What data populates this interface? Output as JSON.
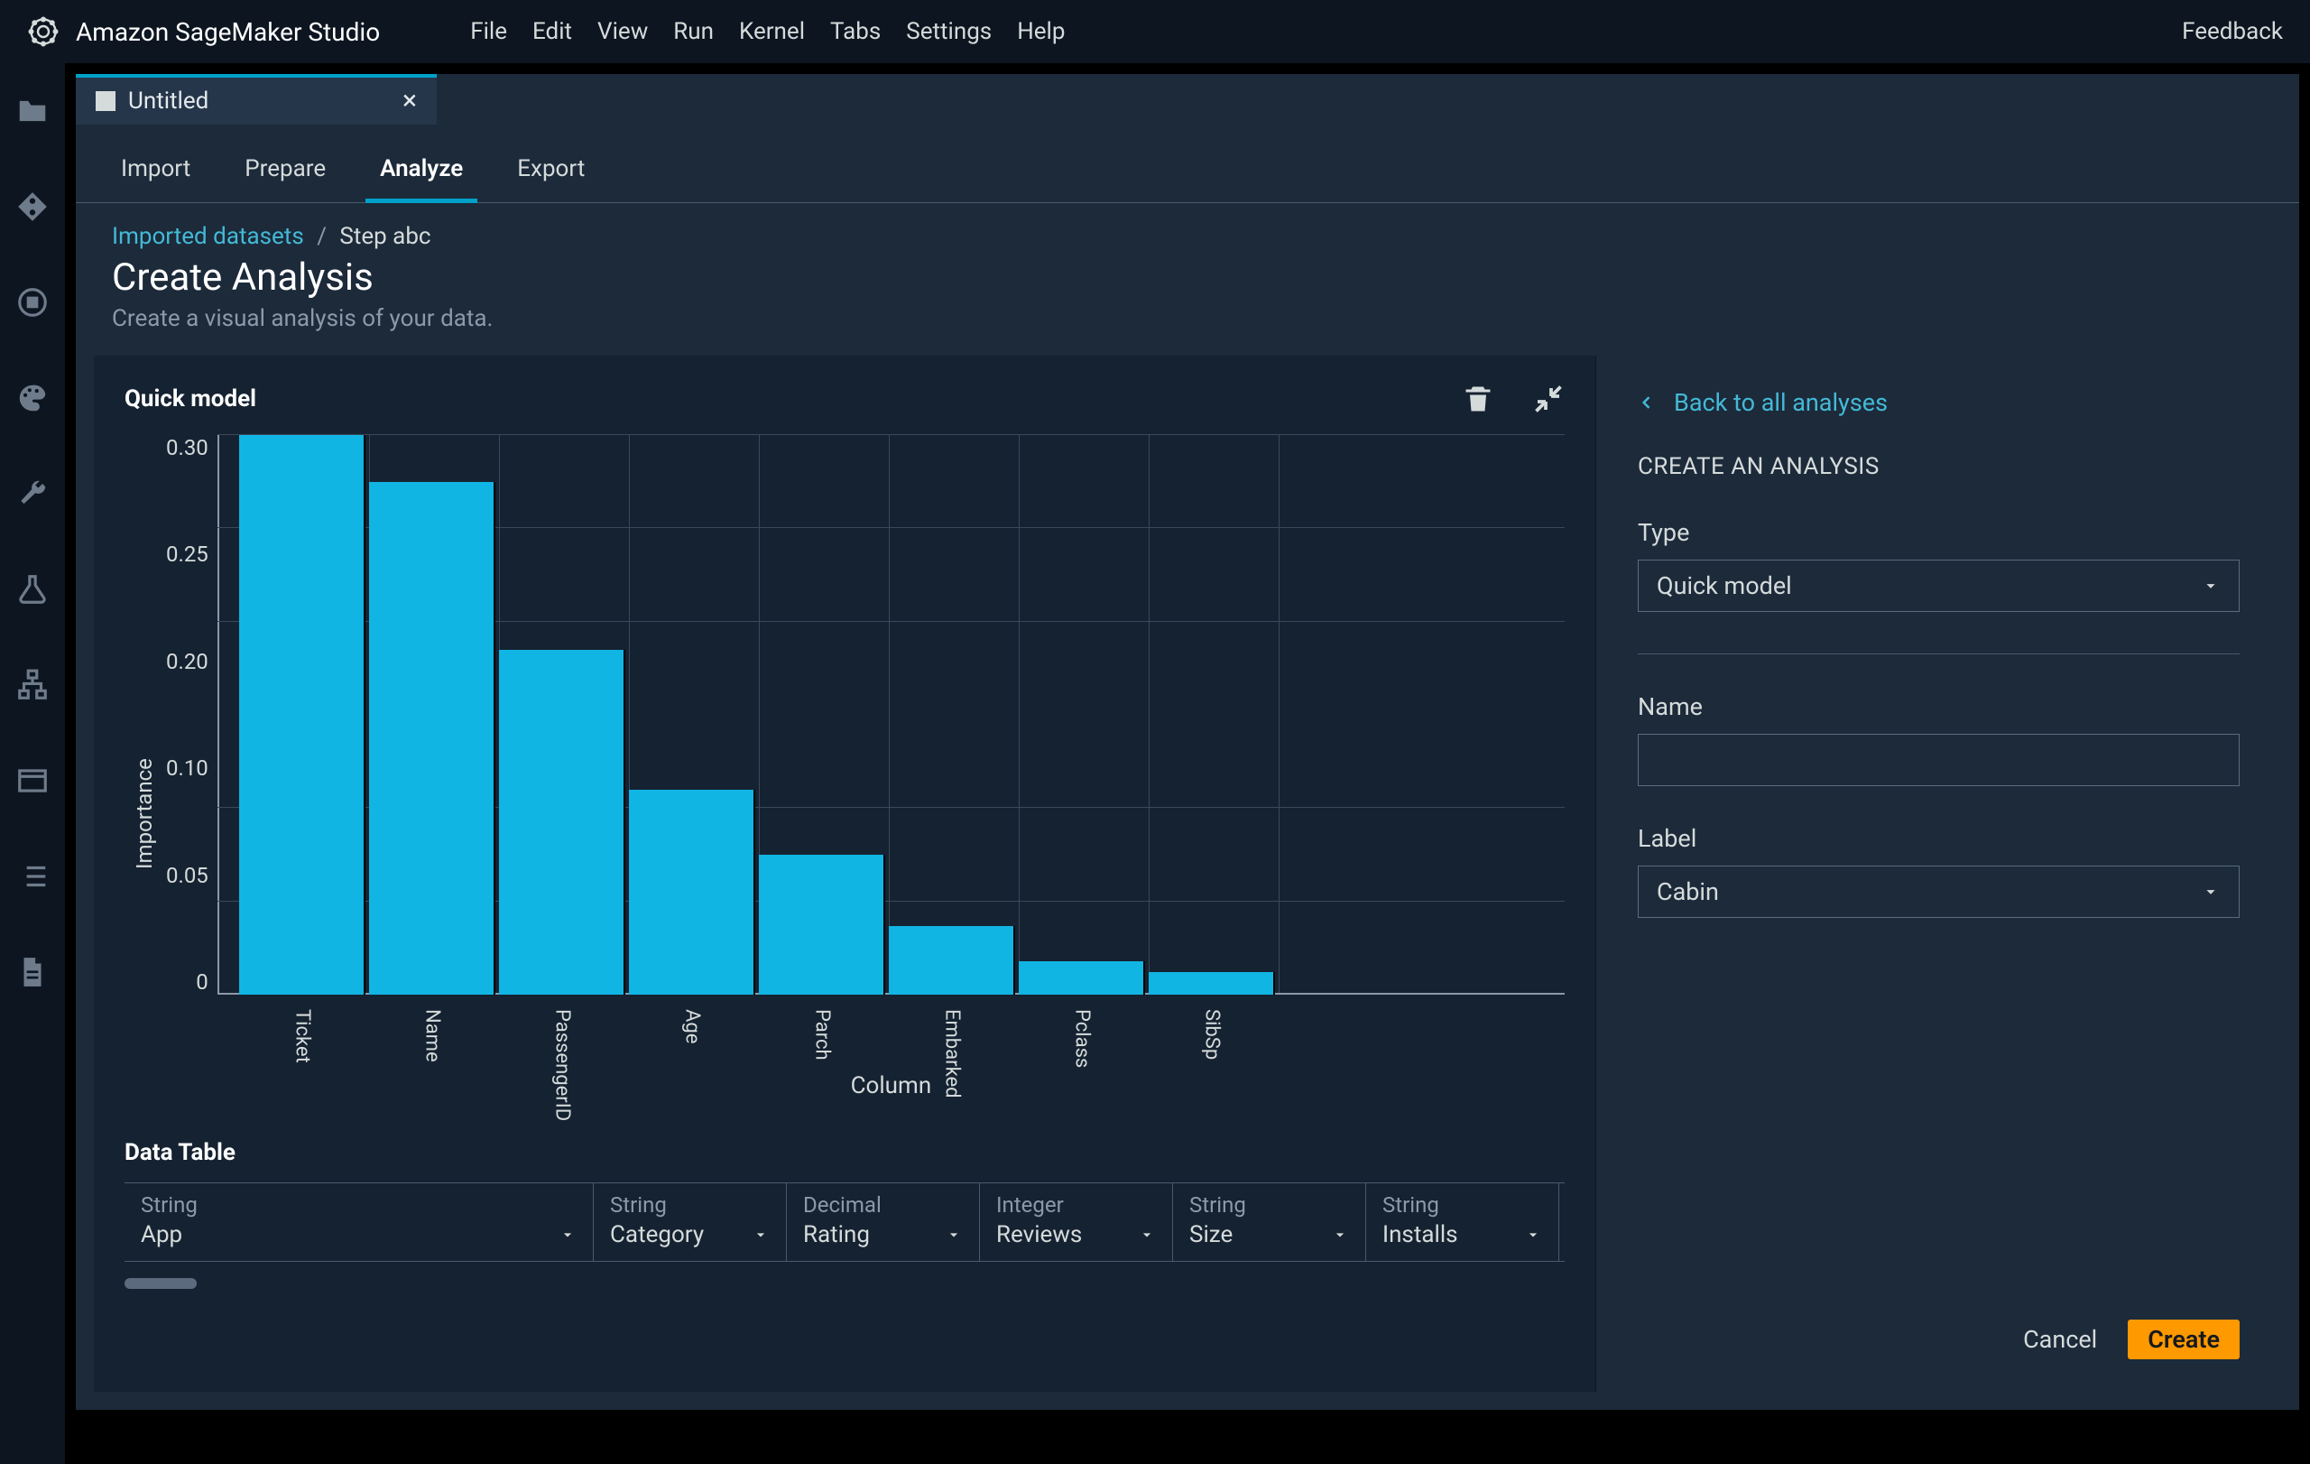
{
  "app": {
    "title": "Amazon SageMaker Studio"
  },
  "menu": {
    "items": [
      "File",
      "Edit",
      "View",
      "Run",
      "Kernel",
      "Tabs",
      "Settings",
      "Help"
    ],
    "feedback": "Feedback"
  },
  "doc_tab": {
    "title": "Untitled"
  },
  "mode_tabs": {
    "items": [
      "Import",
      "Prepare",
      "Analyze",
      "Export"
    ],
    "active": "Analyze"
  },
  "breadcrumb": {
    "link": "Imported datasets",
    "current": "Step abc"
  },
  "page": {
    "title": "Create Analysis",
    "subtitle": "Create a visual analysis of your data."
  },
  "chartpane": {
    "title": "Quick model",
    "data_table_title": "Data Table"
  },
  "chart_data": {
    "type": "bar",
    "title": "Quick model",
    "categories": [
      "Ticket",
      "Name",
      "PassengerID",
      "Age",
      "Parch",
      "Embarked",
      "Pclass",
      "SibSp"
    ],
    "values": [
      0.3,
      0.275,
      0.185,
      0.11,
      0.075,
      0.037,
      0.018,
      0.012
    ],
    "xlabel": "Column",
    "ylabel": "Importance",
    "ylim": [
      0,
      0.3
    ],
    "yticks": [
      0,
      0.05,
      0.1,
      0.2,
      0.25,
      0.3
    ]
  },
  "data_table": {
    "columns": [
      {
        "type": "String",
        "name": "App"
      },
      {
        "type": "String",
        "name": "Category"
      },
      {
        "type": "Decimal",
        "name": "Rating"
      },
      {
        "type": "Integer",
        "name": "Reviews"
      },
      {
        "type": "String",
        "name": "Size"
      },
      {
        "type": "String",
        "name": "Installs"
      }
    ]
  },
  "sidepanel": {
    "back": "Back to all analyses",
    "heading": "CREATE AN ANALYSIS",
    "type_label": "Type",
    "type_value": "Quick model",
    "name_label": "Name",
    "name_value": "",
    "label_label": "Label",
    "label_value": "Cabin",
    "cancel": "Cancel",
    "create": "Create"
  }
}
